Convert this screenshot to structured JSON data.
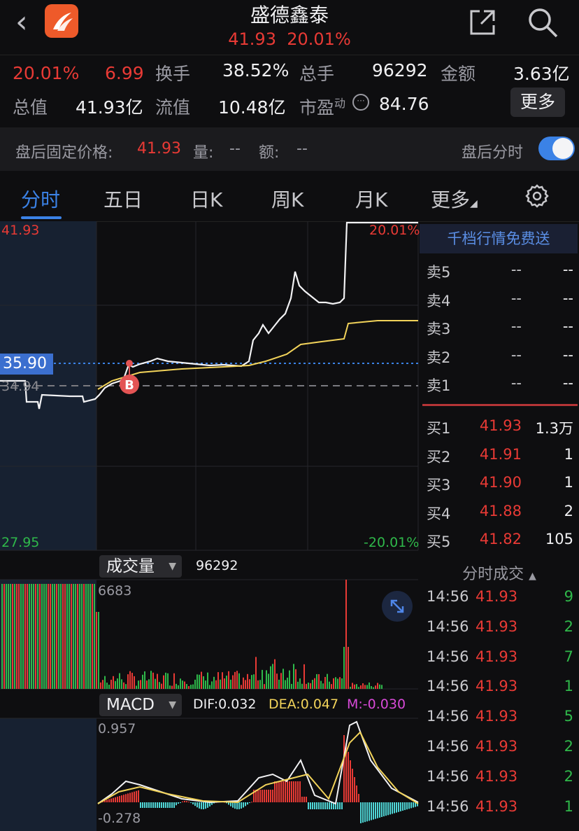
{
  "header": {
    "title": "盛德鑫泰",
    "price": "41.93",
    "change_pct": "20.01%",
    "back_icon": "chevron-left-icon",
    "share_icon": "share-icon",
    "search_icon": "search-icon"
  },
  "stats": {
    "pct": "20.01%",
    "change": "6.99",
    "turnover_label": "换手",
    "turnover": "38.52%",
    "volume_label": "总手",
    "volume": "96292",
    "amount_label": "金额",
    "amount": "3.63亿",
    "mktcap_label": "总值",
    "mktcap": "41.93亿",
    "float_label": "流值",
    "float": "10.48亿",
    "pe_label": "市盈",
    "pe_sup": "动",
    "pe": "84.76",
    "more": "更多"
  },
  "after_hours": {
    "label": "盘后固定价格:",
    "price": "41.93",
    "vol_label": "量:",
    "vol": "--",
    "amt_label": "额:",
    "amt": "--",
    "toggle_label": "盘后分时",
    "toggle_on": true
  },
  "tabs": [
    {
      "label": "分时",
      "active": true
    },
    {
      "label": "五日"
    },
    {
      "label": "日K"
    },
    {
      "label": "周K"
    },
    {
      "label": "月K"
    },
    {
      "label": "更多"
    }
  ],
  "chart": {
    "top_price": "41.93",
    "top_pct": "20.01%",
    "bottom_price": "27.95",
    "bottom_pct": "-20.01%",
    "current_price": "35.90",
    "prev_close": "34.94",
    "marker": "B"
  },
  "volume_panel": {
    "label": "成交量",
    "total": "96292",
    "max": "6683"
  },
  "macd_panel": {
    "label": "MACD",
    "dif": "DIF:0.032",
    "dea": "DEA:0.047",
    "m": "M:-0.030",
    "max": "0.957",
    "min": "-0.278"
  },
  "orderbook": {
    "banner": "千档行情免费送",
    "asks": [
      {
        "label": "卖5",
        "price": "--",
        "vol": "--"
      },
      {
        "label": "卖4",
        "price": "--",
        "vol": "--"
      },
      {
        "label": "卖3",
        "price": "--",
        "vol": "--"
      },
      {
        "label": "卖2",
        "price": "--",
        "vol": "--"
      },
      {
        "label": "卖1",
        "price": "--",
        "vol": "--"
      }
    ],
    "bids": [
      {
        "label": "买1",
        "price": "41.93",
        "vol": "1.3万"
      },
      {
        "label": "买2",
        "price": "41.91",
        "vol": "1"
      },
      {
        "label": "买3",
        "price": "41.90",
        "vol": "1"
      },
      {
        "label": "买4",
        "price": "41.88",
        "vol": "2"
      },
      {
        "label": "买5",
        "price": "41.82",
        "vol": "105"
      }
    ]
  },
  "trades": {
    "title": "分时成交",
    "rows": [
      {
        "time": "14:56",
        "price": "41.93",
        "vol": "9"
      },
      {
        "time": "14:56",
        "price": "41.93",
        "vol": "2"
      },
      {
        "time": "14:56",
        "price": "41.93",
        "vol": "7"
      },
      {
        "time": "14:56",
        "price": "41.93",
        "vol": "1"
      },
      {
        "time": "14:56",
        "price": "41.93",
        "vol": "5"
      },
      {
        "time": "14:56",
        "price": "41.93",
        "vol": "2"
      },
      {
        "time": "14:56",
        "price": "41.93",
        "vol": "2"
      },
      {
        "time": "14:56",
        "price": "41.93",
        "vol": "1"
      }
    ]
  },
  "colors": {
    "up": "#e83a35",
    "down": "#2fb84a",
    "accent": "#3b82e6",
    "avg_line": "#f2d35a"
  }
}
